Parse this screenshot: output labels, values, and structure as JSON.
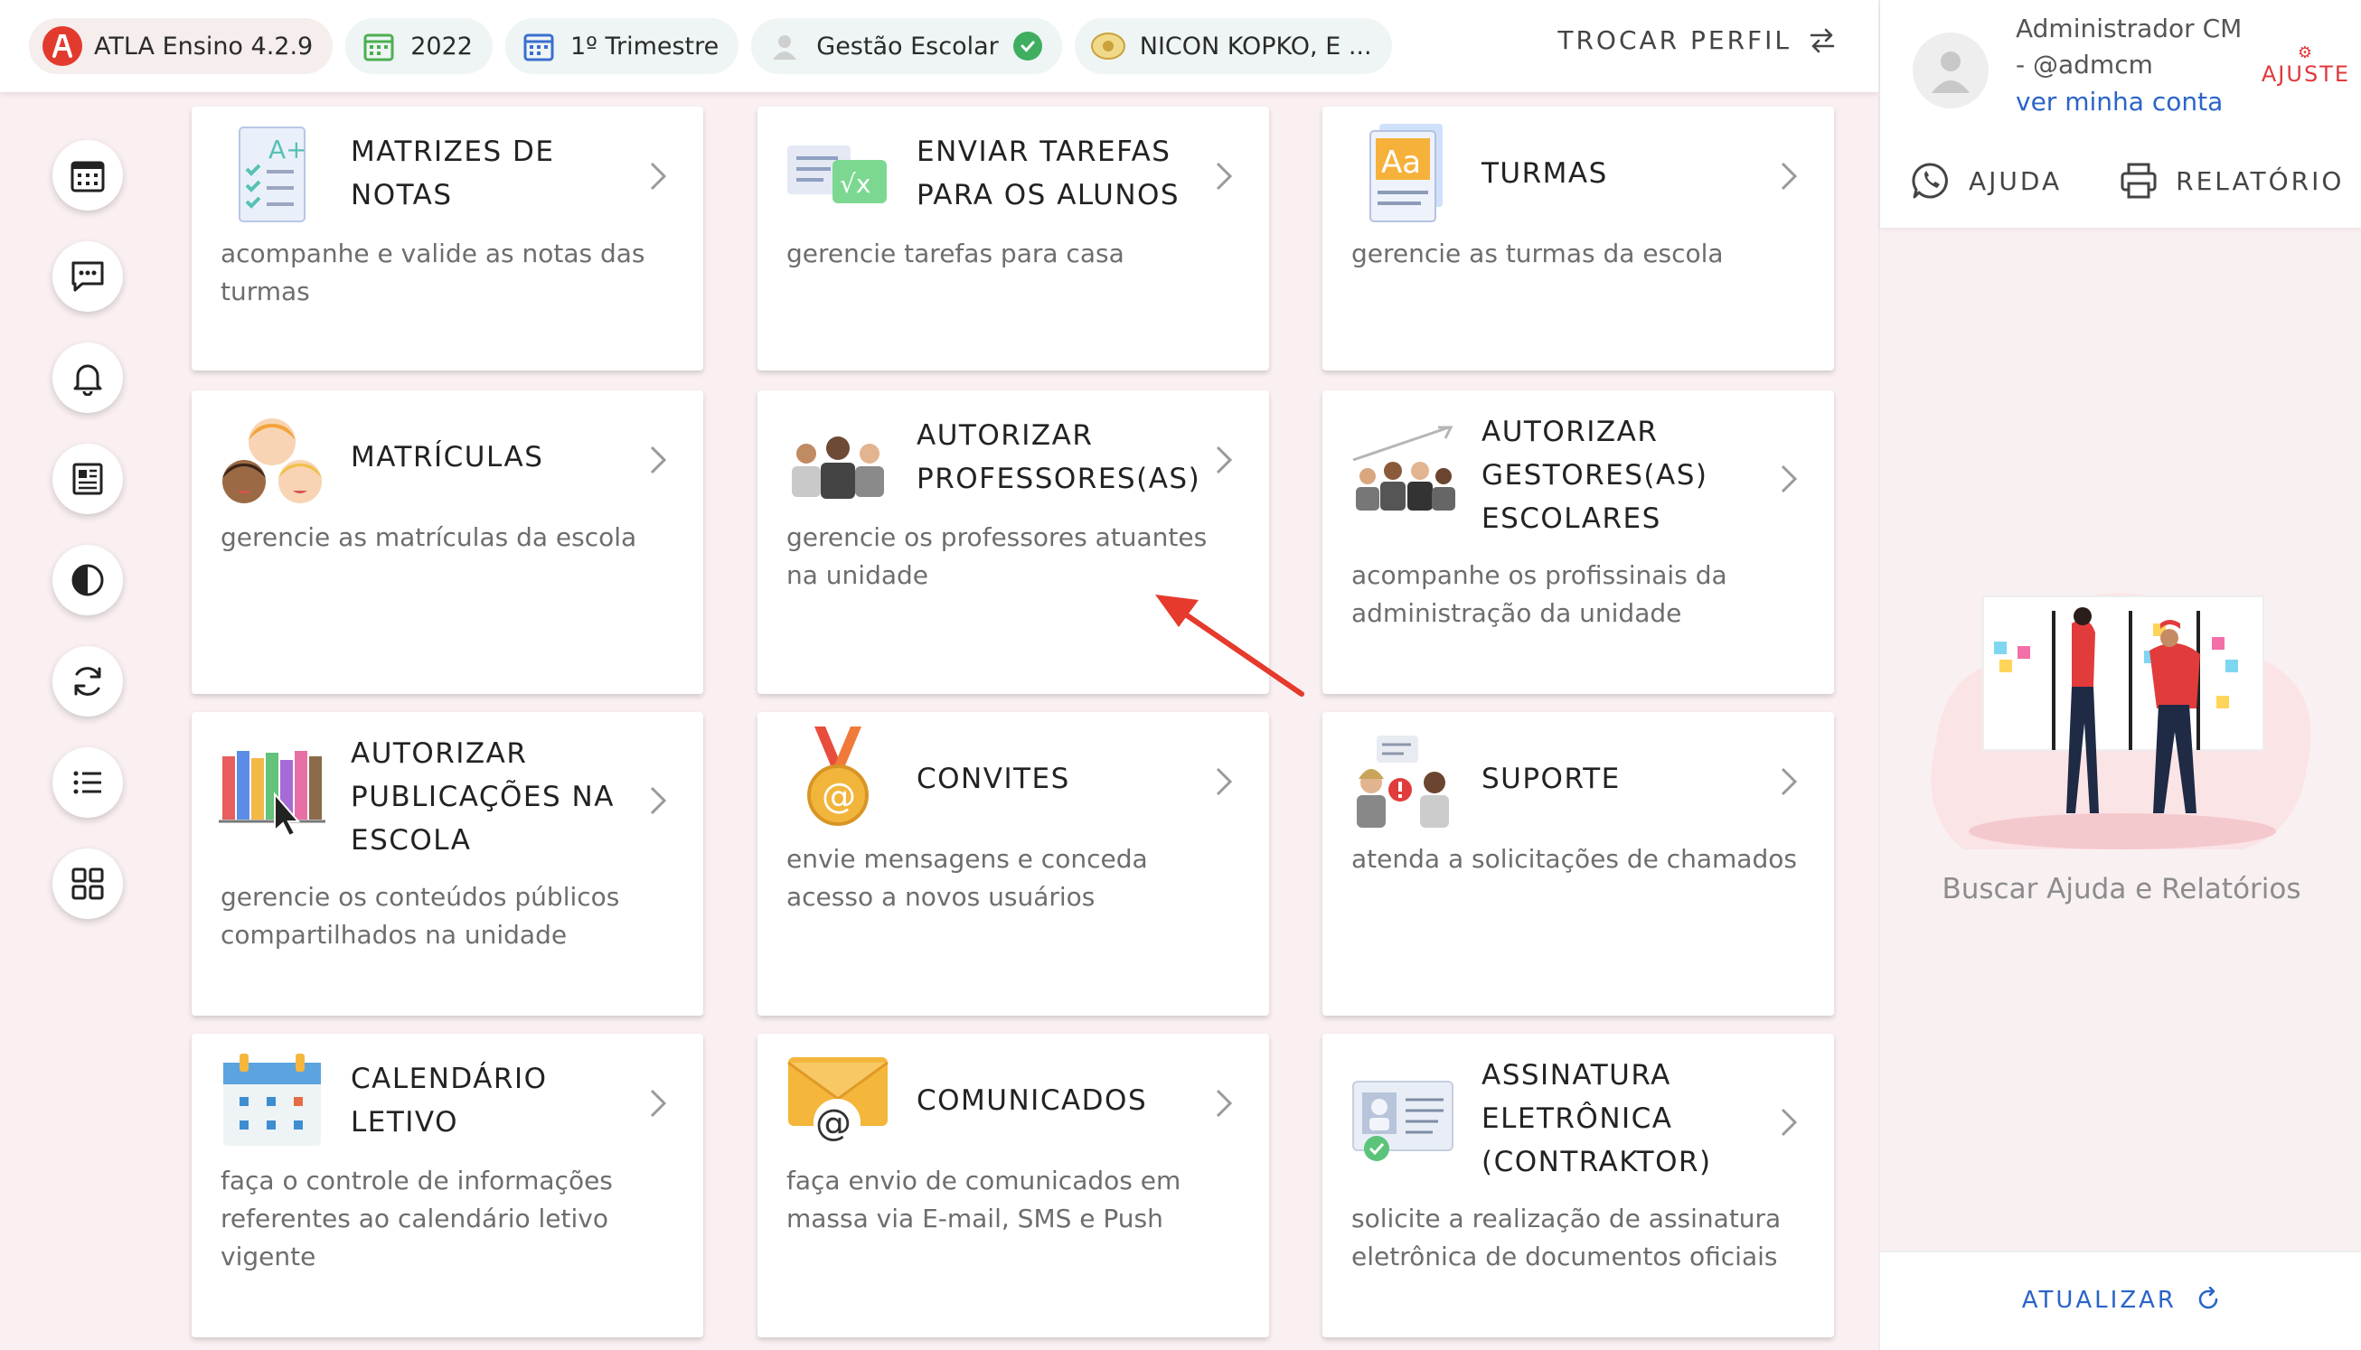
{
  "topbar": {
    "app_version": "ATLA Ensino 4.2.9",
    "year": "2022",
    "period": "1º Trimestre",
    "profile": "Gestão Escolar",
    "school": "NICON KOPKO, E ...",
    "switch_profile": "TROCAR PERFIL"
  },
  "rail": [
    {
      "icon": "calendar-icon"
    },
    {
      "icon": "chat-icon"
    },
    {
      "icon": "bell-icon"
    },
    {
      "icon": "news-icon"
    },
    {
      "icon": "contrast-icon"
    },
    {
      "icon": "sync-icon"
    },
    {
      "icon": "list-icon"
    },
    {
      "icon": "grid-icon"
    }
  ],
  "cards": [
    {
      "title": "MATRIZES DE NOTAS",
      "desc": "acompanhe e valide as notas das turmas",
      "icon": "grades-icon"
    },
    {
      "title": "ENVIAR TAREFAS PARA OS ALUNOS",
      "desc": "gerencie tarefas para casa",
      "icon": "homework-icon"
    },
    {
      "title": "TURMAS",
      "desc": "gerencie as turmas da escola",
      "icon": "classes-icon"
    },
    {
      "title": "MATRÍCULAS",
      "desc": "gerencie as matrículas da escola",
      "icon": "students-icon"
    },
    {
      "title": "AUTORIZAR PROFESSORES(AS)",
      "desc": "gerencie os professores atuantes na unidade",
      "icon": "teachers-icon"
    },
    {
      "title": "AUTORIZAR GESTORES(AS) ESCOLARES",
      "desc": "acompanhe os profissinais da administração da unidade",
      "icon": "managers-icon"
    },
    {
      "title": "AUTORIZAR PUBLICAÇÕES NA ESCOLA",
      "desc": "gerencie os conteúdos públicos compartilhados na unidade",
      "icon": "publications-icon"
    },
    {
      "title": "CONVITES",
      "desc": "envie mensagens e conceda acesso a novos usuários",
      "icon": "invite-medal-icon"
    },
    {
      "title": "SUPORTE",
      "desc": "atenda a solicitações de chamados",
      "icon": "support-icon"
    },
    {
      "title": "CALENDÁRIO LETIVO",
      "desc": "faça o controle de informações referentes ao calendário letivo vigente",
      "icon": "school-calendar-icon"
    },
    {
      "title": "COMUNICADOS",
      "desc": "faça envio de comunicados em massa via E-mail, SMS e Push",
      "icon": "mail-icon"
    },
    {
      "title": "ASSINATURA ELETRÔNICA (CONTRAKTOR)",
      "desc": "solicite a realização de assinatura eletrônica de documentos oficiais",
      "icon": "signature-icon"
    }
  ],
  "user": {
    "name": "Administrador CM - @admcm",
    "account_link": "ver minha conta",
    "ajuste": "AJUSTE"
  },
  "panel": {
    "help": "AJUDA",
    "report": "RELATÓRIO",
    "search_text": "Buscar Ajuda e Relatórios",
    "refresh": "ATUALIZAR"
  },
  "colors": {
    "accent_blue": "#2a64c8",
    "brand_red": "#e0383a",
    "background": "#faf0f1",
    "check_green": "#3fae60"
  }
}
